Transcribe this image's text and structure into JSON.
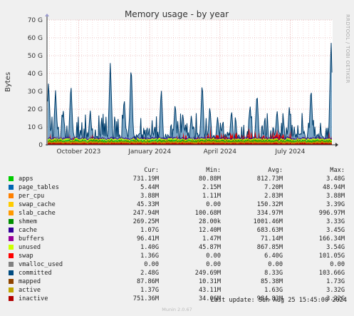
{
  "chart_data": {
    "type": "area",
    "title": "Memory usage - by year",
    "ylabel": "Bytes",
    "side_label": "RRDTOOL / TOBI OETIKER",
    "ylim": [
      0,
      70
    ],
    "y_unit": "G",
    "y_ticks": [
      "0",
      "10 G",
      "20 G",
      "30 G",
      "40 G",
      "50 G",
      "60 G",
      "70 G"
    ],
    "x_ticks": [
      "October 2023",
      "January 2024",
      "April 2024",
      "July 2024"
    ],
    "x_range": [
      "2023-08-21",
      "2024-08-25"
    ],
    "x_tick_dates": [
      "2023-10-01",
      "2024-01-01",
      "2024-04-01",
      "2024-07-01"
    ],
    "grid": true,
    "committed_peaks": [
      {
        "date": "2023-08-23",
        "value": 36
      },
      {
        "date": "2023-09-01",
        "value": 31
      },
      {
        "date": "2023-09-11",
        "value": 20
      },
      {
        "date": "2023-09-21",
        "value": 35
      },
      {
        "date": "2023-10-16",
        "value": 20
      },
      {
        "date": "2023-11-11",
        "value": 47
      },
      {
        "date": "2023-11-29",
        "value": 27
      },
      {
        "date": "2023-12-08",
        "value": 46
      },
      {
        "date": "2024-01-16",
        "value": 32
      },
      {
        "date": "2024-02-03",
        "value": 24
      },
      {
        "date": "2024-02-13",
        "value": 18
      },
      {
        "date": "2024-02-24",
        "value": 17
      },
      {
        "date": "2024-03-09",
        "value": 36
      },
      {
        "date": "2024-03-19",
        "value": 22
      },
      {
        "date": "2024-03-29",
        "value": 16
      },
      {
        "date": "2024-04-16",
        "value": 20
      },
      {
        "date": "2024-05-10",
        "value": 23
      },
      {
        "date": "2024-05-19",
        "value": 30
      },
      {
        "date": "2024-06-14",
        "value": 20
      },
      {
        "date": "2024-06-30",
        "value": 22
      },
      {
        "date": "2024-07-28",
        "value": 33
      },
      {
        "date": "2024-08-23",
        "value": 60
      }
    ]
  },
  "legend": {
    "headers": {
      "cur": "Cur:",
      "min": "Min:",
      "avg": "Avg:",
      "max": "Max:"
    },
    "rows": [
      {
        "name": "apps",
        "color": "#00cc00",
        "cur": "731.19M",
        "min": "80.88M",
        "avg": "812.73M",
        "max": "3.48G"
      },
      {
        "name": "page_tables",
        "color": "#0066b3",
        "cur": "5.44M",
        "min": "2.15M",
        "avg": "7.20M",
        "max": "48.94M"
      },
      {
        "name": "per_cpu",
        "color": "#ff8000",
        "cur": "3.88M",
        "min": "1.11M",
        "avg": "2.83M",
        "max": "3.88M"
      },
      {
        "name": "swap_cache",
        "color": "#ffcc00",
        "cur": "45.33M",
        "min": "0.00",
        "avg": "150.32M",
        "max": "3.39G"
      },
      {
        "name": "slab_cache",
        "color": "#ff9900",
        "cur": "247.94M",
        "min": "100.68M",
        "avg": "334.97M",
        "max": "996.97M"
      },
      {
        "name": "shmem",
        "color": "#008f00",
        "cur": "269.25M",
        "min": "28.00k",
        "avg": "1001.46M",
        "max": "3.33G"
      },
      {
        "name": "cache",
        "color": "#330099",
        "cur": "1.07G",
        "min": "12.40M",
        "avg": "683.63M",
        "max": "3.45G"
      },
      {
        "name": "buffers",
        "color": "#990099",
        "cur": "96.41M",
        "min": "1.47M",
        "avg": "71.14M",
        "max": "166.34M"
      },
      {
        "name": "unused",
        "color": "#ccff00",
        "cur": "1.40G",
        "min": "45.87M",
        "avg": "867.85M",
        "max": "3.54G"
      },
      {
        "name": "swap",
        "color": "#ff0000",
        "cur": "1.36G",
        "min": "0.00",
        "avg": "6.40G",
        "max": "101.05G"
      },
      {
        "name": "vmalloc_used",
        "color": "#808080",
        "cur": "0.00",
        "min": "0.00",
        "avg": "0.00",
        "max": "0.00"
      },
      {
        "name": "committed",
        "color": "#004b80",
        "cur": "2.48G",
        "min": "249.69M",
        "avg": "8.33G",
        "max": "103.66G"
      },
      {
        "name": "mapped",
        "color": "#8f4500",
        "cur": "87.86M",
        "min": "10.31M",
        "avg": "85.38M",
        "max": "1.73G"
      },
      {
        "name": "active",
        "color": "#bfa600",
        "cur": "1.37G",
        "min": "43.11M",
        "avg": "1.63G",
        "max": "3.32G"
      },
      {
        "name": "inactive",
        "color": "#b30000",
        "cur": "751.36M",
        "min": "34.06M",
        "avg": "984.83M",
        "max": "3.22G"
      }
    ]
  },
  "last_update": "Last update:  Sun Aug 25 15:45:00 2024",
  "version": "Munin 2.0.67"
}
